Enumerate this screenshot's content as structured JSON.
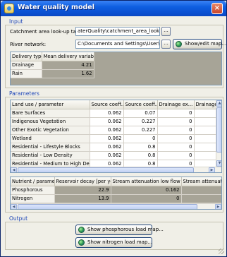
{
  "window": {
    "title": "Water quality model",
    "close_glyph": "×"
  },
  "input": {
    "section_label": "Input",
    "catchment_label": "Catchment area look-up table:",
    "catchment_value": "aterQuality\\catchment_area_lookup.dat",
    "river_label": "River network:",
    "river_value": "C:\\Documents and Settings\\User\\My doc",
    "browse_label": "...",
    "show_map_label": "Show/edit map...",
    "delivery": {
      "headers": [
        "Delivery type",
        "Mean delivery variable"
      ],
      "rows": [
        {
          "type": "Drainage",
          "value": "4.21"
        },
        {
          "type": "Rain",
          "value": "1.62"
        }
      ]
    }
  },
  "parameters": {
    "section_label": "Parameters",
    "land_use": {
      "headers": [
        "Land use / parameter",
        "Source coeff...",
        "Source coeff...",
        "Drainage ex...",
        "Drainage e"
      ],
      "rows": [
        {
          "name": "Bare Surfaces",
          "c1": "0.062",
          "c2": "0.07",
          "c3": "0",
          "c4": ""
        },
        {
          "name": "Indigenous Vegetation",
          "c1": "0.062",
          "c2": "0.227",
          "c3": "0",
          "c4": ""
        },
        {
          "name": "Other Exotic Vegetation",
          "c1": "0.062",
          "c2": "0.227",
          "c3": "0",
          "c4": ""
        },
        {
          "name": "Wetland",
          "c1": "0.062",
          "c2": "0",
          "c3": "0",
          "c4": ""
        },
        {
          "name": "Residential - Lifestyle Blocks",
          "c1": "0.062",
          "c2": "0.8",
          "c3": "0",
          "c4": ""
        },
        {
          "name": "Residential - Low Density",
          "c1": "0.062",
          "c2": "0.8",
          "c3": "0",
          "c4": ""
        },
        {
          "name": "Residential - Medium to High Density",
          "c1": "0.062",
          "c2": "0.8",
          "c3": "0",
          "c4": ""
        }
      ]
    },
    "nutrient": {
      "headers": [
        "Nutrient / parameter",
        "Reservoir decay [per year]",
        "Stream attenuation low flow",
        "Stream attenuati"
      ],
      "rows": [
        {
          "name": "Phosphorous",
          "decay": "22.9",
          "low": "0.162",
          "high": ""
        },
        {
          "name": "Nitrogen",
          "decay": "13.9",
          "low": "0",
          "high": ""
        }
      ]
    }
  },
  "output": {
    "section_label": "Output",
    "phosphorous_button": "Show phosphorous load map...",
    "nitrogen_button": "Show nitrogen load map..."
  },
  "icons": {
    "map_button_icon": "globe-icon",
    "window_icon": "app-icon"
  }
}
